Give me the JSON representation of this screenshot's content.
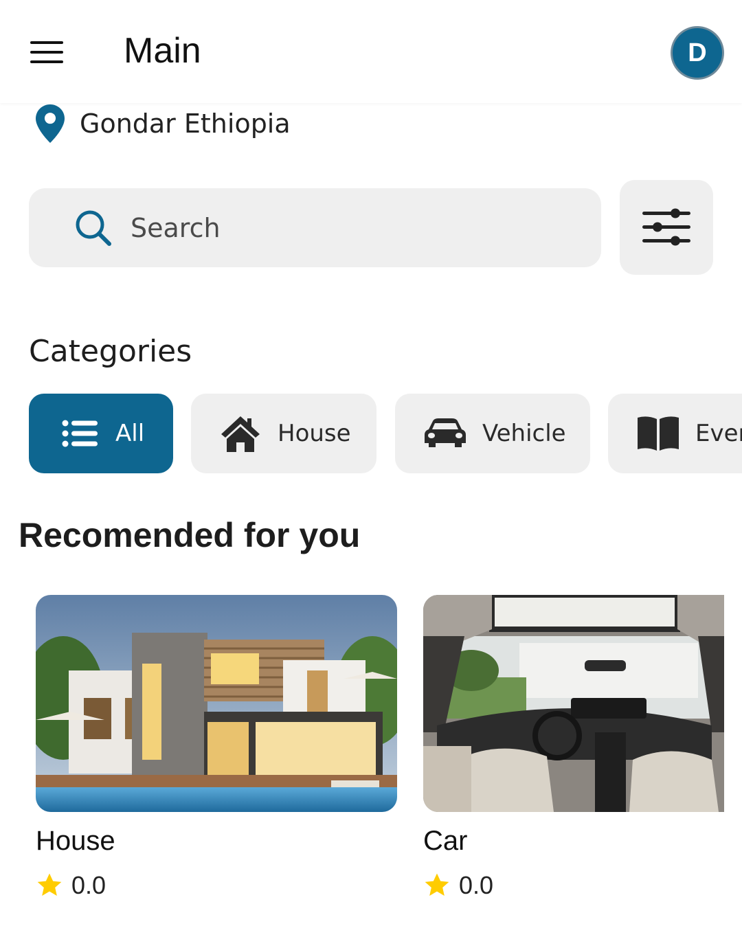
{
  "app": {
    "title": "Main",
    "avatar_initial": "D",
    "accent_color": "#0e6690"
  },
  "location": {
    "text": "Gondar Ethiopia",
    "icon": "location-pin-icon"
  },
  "search": {
    "placeholder": "Search",
    "value": "",
    "icon": "search-icon",
    "filter_icon": "sliders-icon"
  },
  "categories": {
    "title": "Categories",
    "items": [
      {
        "label": "All",
        "icon": "list-icon",
        "active": true
      },
      {
        "label": "House",
        "icon": "house-icon",
        "active": false
      },
      {
        "label": "Vehicle",
        "icon": "car-icon",
        "active": false
      },
      {
        "label": "Ever",
        "icon": "book-icon",
        "active": false
      }
    ]
  },
  "recommended": {
    "title": "Recomended for you",
    "items": [
      {
        "title": "House",
        "rating": "0.0",
        "image": "modern-house-photo"
      },
      {
        "title": "Car",
        "rating": "0.0",
        "image": "car-interior-photo"
      }
    ]
  },
  "colors": {
    "star": "#ffcc00",
    "chip_bg": "#efefef"
  }
}
